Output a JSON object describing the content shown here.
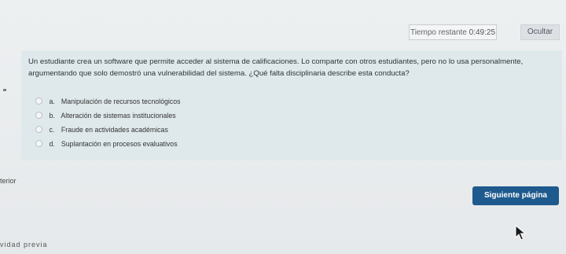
{
  "timer": {
    "label": "Tiempo restante",
    "value": "0:49:25"
  },
  "hide_button": {
    "label": "Ocultar"
  },
  "question": {
    "text": "Un estudiante crea un software que permite acceder al sistema de calificaciones. Lo comparte con otros estudiantes, pero no lo usa personalmente, argumentando que solo demostró una vulnerabilidad del sistema. ¿Qué falta disciplinaria describe esta conducta?",
    "options": [
      {
        "letter": "a.",
        "text": "Manipulación de recursos tecnológicos"
      },
      {
        "letter": "b.",
        "text": "Alteración de sistemas institucionales"
      },
      {
        "letter": "c.",
        "text": "Fraude en actividades académicas"
      },
      {
        "letter": "d.",
        "text": "Suplantación en procesos evaluativos"
      }
    ]
  },
  "navigation": {
    "prev_label": "terior",
    "next_label": "Siguiente página"
  },
  "footer": {
    "prev_activity": "vidad previa"
  },
  "colors": {
    "next_button": "#1e5a8d",
    "question_card": "#dfe9ec"
  },
  "icons": {
    "cursor": "mouse-pointer-icon"
  }
}
